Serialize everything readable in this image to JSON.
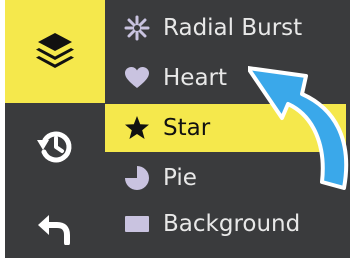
{
  "menu": {
    "items": [
      {
        "label": "Radial Burst",
        "icon": "radial-burst-icon"
      },
      {
        "label": "Heart",
        "icon": "heart-icon"
      },
      {
        "label": "Star",
        "icon": "star-icon",
        "selected": true
      },
      {
        "label": "Pie",
        "icon": "pie-icon"
      },
      {
        "label": "Background",
        "icon": "background-icon"
      }
    ]
  },
  "rail": {
    "buttons": [
      {
        "name": "layers",
        "icon": "layers-icon",
        "active": true
      },
      {
        "name": "history",
        "icon": "history-icon"
      },
      {
        "name": "back",
        "icon": "back-arrow-icon"
      }
    ]
  },
  "colors": {
    "panel": "#3a3b3d",
    "accent": "#f5e84c",
    "text": "#e8e8e8",
    "icon": "#c9c3e0",
    "pointer": "#3aa8ea"
  }
}
